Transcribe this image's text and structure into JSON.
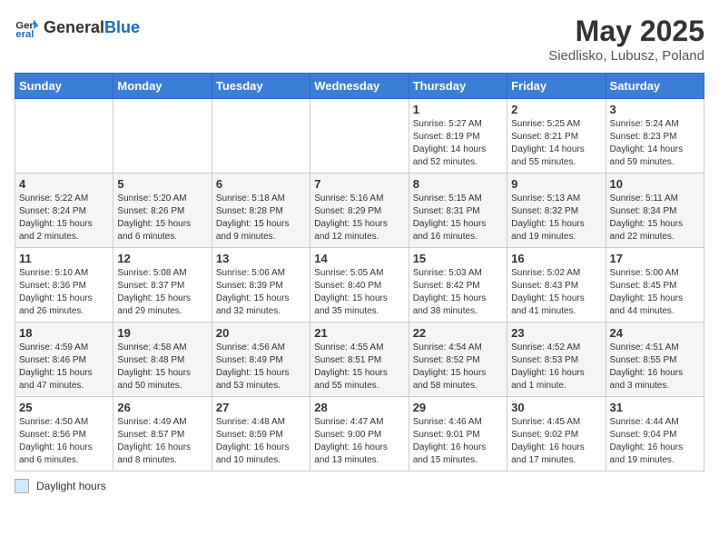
{
  "header": {
    "logo_general": "General",
    "logo_blue": "Blue",
    "title": "May 2025",
    "subtitle": "Siedlisko, Lubusz, Poland"
  },
  "weekdays": [
    "Sunday",
    "Monday",
    "Tuesday",
    "Wednesday",
    "Thursday",
    "Friday",
    "Saturday"
  ],
  "footer": {
    "legend_label": "Daylight hours"
  },
  "weeks": [
    [
      {
        "day": "",
        "sunrise": "",
        "sunset": "",
        "daylight": ""
      },
      {
        "day": "",
        "sunrise": "",
        "sunset": "",
        "daylight": ""
      },
      {
        "day": "",
        "sunrise": "",
        "sunset": "",
        "daylight": ""
      },
      {
        "day": "",
        "sunrise": "",
        "sunset": "",
        "daylight": ""
      },
      {
        "day": "1",
        "sunrise": "Sunrise: 5:27 AM",
        "sunset": "Sunset: 8:19 PM",
        "daylight": "Daylight: 14 hours and 52 minutes."
      },
      {
        "day": "2",
        "sunrise": "Sunrise: 5:25 AM",
        "sunset": "Sunset: 8:21 PM",
        "daylight": "Daylight: 14 hours and 55 minutes."
      },
      {
        "day": "3",
        "sunrise": "Sunrise: 5:24 AM",
        "sunset": "Sunset: 8:23 PM",
        "daylight": "Daylight: 14 hours and 59 minutes."
      }
    ],
    [
      {
        "day": "4",
        "sunrise": "Sunrise: 5:22 AM",
        "sunset": "Sunset: 8:24 PM",
        "daylight": "Daylight: 15 hours and 2 minutes."
      },
      {
        "day": "5",
        "sunrise": "Sunrise: 5:20 AM",
        "sunset": "Sunset: 8:26 PM",
        "daylight": "Daylight: 15 hours and 6 minutes."
      },
      {
        "day": "6",
        "sunrise": "Sunrise: 5:18 AM",
        "sunset": "Sunset: 8:28 PM",
        "daylight": "Daylight: 15 hours and 9 minutes."
      },
      {
        "day": "7",
        "sunrise": "Sunrise: 5:16 AM",
        "sunset": "Sunset: 8:29 PM",
        "daylight": "Daylight: 15 hours and 12 minutes."
      },
      {
        "day": "8",
        "sunrise": "Sunrise: 5:15 AM",
        "sunset": "Sunset: 8:31 PM",
        "daylight": "Daylight: 15 hours and 16 minutes."
      },
      {
        "day": "9",
        "sunrise": "Sunrise: 5:13 AM",
        "sunset": "Sunset: 8:32 PM",
        "daylight": "Daylight: 15 hours and 19 minutes."
      },
      {
        "day": "10",
        "sunrise": "Sunrise: 5:11 AM",
        "sunset": "Sunset: 8:34 PM",
        "daylight": "Daylight: 15 hours and 22 minutes."
      }
    ],
    [
      {
        "day": "11",
        "sunrise": "Sunrise: 5:10 AM",
        "sunset": "Sunset: 8:36 PM",
        "daylight": "Daylight: 15 hours and 26 minutes."
      },
      {
        "day": "12",
        "sunrise": "Sunrise: 5:08 AM",
        "sunset": "Sunset: 8:37 PM",
        "daylight": "Daylight: 15 hours and 29 minutes."
      },
      {
        "day": "13",
        "sunrise": "Sunrise: 5:06 AM",
        "sunset": "Sunset: 8:39 PM",
        "daylight": "Daylight: 15 hours and 32 minutes."
      },
      {
        "day": "14",
        "sunrise": "Sunrise: 5:05 AM",
        "sunset": "Sunset: 8:40 PM",
        "daylight": "Daylight: 15 hours and 35 minutes."
      },
      {
        "day": "15",
        "sunrise": "Sunrise: 5:03 AM",
        "sunset": "Sunset: 8:42 PM",
        "daylight": "Daylight: 15 hours and 38 minutes."
      },
      {
        "day": "16",
        "sunrise": "Sunrise: 5:02 AM",
        "sunset": "Sunset: 8:43 PM",
        "daylight": "Daylight: 15 hours and 41 minutes."
      },
      {
        "day": "17",
        "sunrise": "Sunrise: 5:00 AM",
        "sunset": "Sunset: 8:45 PM",
        "daylight": "Daylight: 15 hours and 44 minutes."
      }
    ],
    [
      {
        "day": "18",
        "sunrise": "Sunrise: 4:59 AM",
        "sunset": "Sunset: 8:46 PM",
        "daylight": "Daylight: 15 hours and 47 minutes."
      },
      {
        "day": "19",
        "sunrise": "Sunrise: 4:58 AM",
        "sunset": "Sunset: 8:48 PM",
        "daylight": "Daylight: 15 hours and 50 minutes."
      },
      {
        "day": "20",
        "sunrise": "Sunrise: 4:56 AM",
        "sunset": "Sunset: 8:49 PM",
        "daylight": "Daylight: 15 hours and 53 minutes."
      },
      {
        "day": "21",
        "sunrise": "Sunrise: 4:55 AM",
        "sunset": "Sunset: 8:51 PM",
        "daylight": "Daylight: 15 hours and 55 minutes."
      },
      {
        "day": "22",
        "sunrise": "Sunrise: 4:54 AM",
        "sunset": "Sunset: 8:52 PM",
        "daylight": "Daylight: 15 hours and 58 minutes."
      },
      {
        "day": "23",
        "sunrise": "Sunrise: 4:52 AM",
        "sunset": "Sunset: 8:53 PM",
        "daylight": "Daylight: 16 hours and 1 minute."
      },
      {
        "day": "24",
        "sunrise": "Sunrise: 4:51 AM",
        "sunset": "Sunset: 8:55 PM",
        "daylight": "Daylight: 16 hours and 3 minutes."
      }
    ],
    [
      {
        "day": "25",
        "sunrise": "Sunrise: 4:50 AM",
        "sunset": "Sunset: 8:56 PM",
        "daylight": "Daylight: 16 hours and 6 minutes."
      },
      {
        "day": "26",
        "sunrise": "Sunrise: 4:49 AM",
        "sunset": "Sunset: 8:57 PM",
        "daylight": "Daylight: 16 hours and 8 minutes."
      },
      {
        "day": "27",
        "sunrise": "Sunrise: 4:48 AM",
        "sunset": "Sunset: 8:59 PM",
        "daylight": "Daylight: 16 hours and 10 minutes."
      },
      {
        "day": "28",
        "sunrise": "Sunrise: 4:47 AM",
        "sunset": "Sunset: 9:00 PM",
        "daylight": "Daylight: 16 hours and 13 minutes."
      },
      {
        "day": "29",
        "sunrise": "Sunrise: 4:46 AM",
        "sunset": "Sunset: 9:01 PM",
        "daylight": "Daylight: 16 hours and 15 minutes."
      },
      {
        "day": "30",
        "sunrise": "Sunrise: 4:45 AM",
        "sunset": "Sunset: 9:02 PM",
        "daylight": "Daylight: 16 hours and 17 minutes."
      },
      {
        "day": "31",
        "sunrise": "Sunrise: 4:44 AM",
        "sunset": "Sunset: 9:04 PM",
        "daylight": "Daylight: 16 hours and 19 minutes."
      }
    ]
  ]
}
